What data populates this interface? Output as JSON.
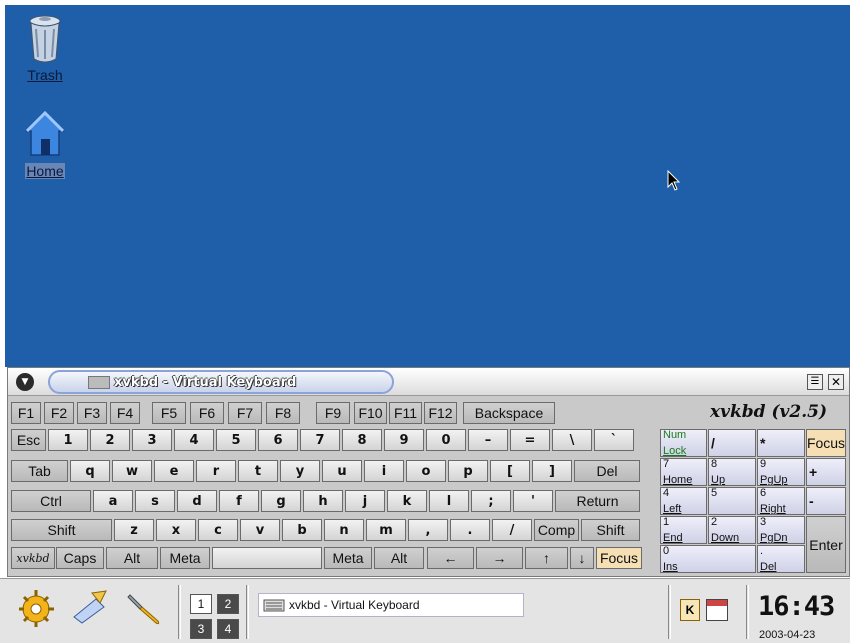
{
  "desktop": {
    "icons": [
      {
        "label": "Trash",
        "icon": "trash-icon"
      },
      {
        "label": "Home",
        "icon": "home-icon"
      }
    ],
    "colors": {
      "background": "#1f5ea8"
    }
  },
  "window": {
    "title": "xvkbd - Virtual Keyboard",
    "brand": "xvkbd (v2.5)",
    "rows": {
      "function": [
        "F1",
        "F2",
        "F3",
        "F4",
        "F5",
        "F6",
        "F7",
        "F8",
        "F9",
        "F10",
        "F11",
        "F12",
        "Backspace"
      ],
      "number": [
        "Esc",
        "1",
        "2",
        "3",
        "4",
        "5",
        "6",
        "7",
        "8",
        "9",
        "0",
        "–",
        "=",
        "\\",
        "`"
      ],
      "top": [
        "Tab",
        "q",
        "w",
        "e",
        "r",
        "t",
        "y",
        "u",
        "i",
        "o",
        "p",
        "[",
        "]",
        "Del"
      ],
      "home": [
        "Ctrl",
        "a",
        "s",
        "d",
        "f",
        "g",
        "h",
        "j",
        "k",
        "l",
        ";",
        "'",
        "Return"
      ],
      "bottom": [
        "Shift",
        "z",
        "x",
        "c",
        "v",
        "b",
        "n",
        "m",
        ",",
        ".",
        "/",
        "Comp",
        "Shift"
      ],
      "space": [
        "xvkbd",
        "Caps",
        "Alt",
        "Meta",
        "",
        "Meta",
        "Alt",
        "←",
        "→",
        "↑",
        "↓",
        "Focus"
      ]
    },
    "numpad": {
      "numlock": {
        "top": "Num",
        "bot": "Lock"
      },
      "slash": "/",
      "star": "*",
      "focus": "Focus",
      "k7": {
        "top": "7",
        "bot": "Home"
      },
      "k8": {
        "top": "8",
        "bot": "Up"
      },
      "k9": {
        "top": "9",
        "bot": "PgUp"
      },
      "plus": "+",
      "k4": {
        "top": "4",
        "bot": "Left"
      },
      "k5": {
        "top": "5",
        "bot": ""
      },
      "k6": {
        "top": "6",
        "bot": "Right"
      },
      "minus": "-",
      "k1": {
        "top": "1",
        "bot": "End"
      },
      "k2": {
        "top": "2",
        "bot": "Down"
      },
      "k3": {
        "top": "3",
        "bot": "PgDn"
      },
      "enter": "Enter",
      "k0": {
        "top": "0",
        "bot": "Ins"
      },
      "kdot": {
        "top": ".",
        "bot": "Del"
      }
    }
  },
  "taskbar": {
    "launchers": [
      "kde-gear-icon",
      "edit-pen-icon",
      "tools-wrench-icon"
    ],
    "pager": [
      "1",
      "2",
      "3",
      "4"
    ],
    "active_desktop": "1",
    "task_label": "xvkbd - Virtual Keyboard",
    "tray": [
      "klipper-icon",
      "calendar-icon"
    ],
    "clock": "16:43",
    "date": "2003-04-23"
  }
}
